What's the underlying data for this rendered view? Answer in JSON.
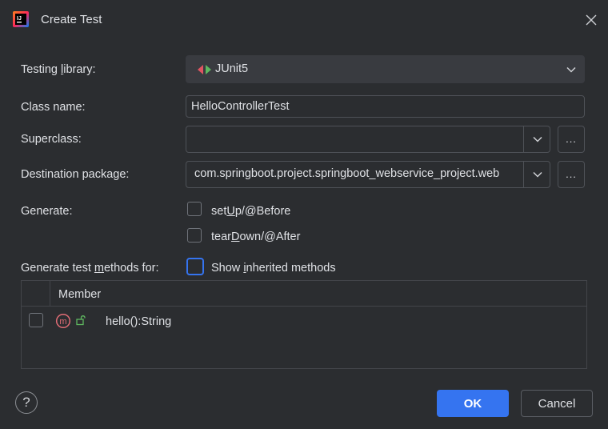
{
  "dialog": {
    "title": "Create Test",
    "app_icon": "intellij-idea-icon",
    "close_icon": "close-icon"
  },
  "testing_library": {
    "label_pre": "Testing ",
    "label_mn": "l",
    "label_post": "ibrary:",
    "value": "JUnit5",
    "icon": "junit5-icon"
  },
  "class_name": {
    "label": "Class name:",
    "value": "HelloControllerTest"
  },
  "superclass": {
    "label": "Superclass:",
    "value": "",
    "browse_label": "..."
  },
  "destination_package": {
    "label": "Destination package:",
    "value": "com.springboot.project.springboot_webservice_project.web",
    "browse_label": "..."
  },
  "generate": {
    "label": "Generate:",
    "setup": {
      "pre": "set",
      "mn": "U",
      "post": "p/@Before",
      "checked": false
    },
    "teardown": {
      "pre": "tear",
      "mn": "D",
      "post": "own/@After",
      "checked": false
    }
  },
  "methods": {
    "label_pre": "Generate test ",
    "label_mn": "m",
    "label_post": "ethods for:",
    "show_inherited": {
      "pre": "Show ",
      "mn": "i",
      "post": "nherited methods",
      "checked": false
    }
  },
  "members_table": {
    "header": "Member",
    "rows": [
      {
        "name": "hello():String",
        "icon": "method-icon",
        "visibility_icon": "public-visibility-icon",
        "checked": false
      }
    ]
  },
  "footer": {
    "help": "?",
    "ok": "OK",
    "cancel": "Cancel"
  },
  "colors": {
    "accent": "#3574f0",
    "background": "#2b2d30",
    "border": "#4e5157",
    "method_icon": "#e06c75",
    "public_icon": "#5fb760"
  }
}
